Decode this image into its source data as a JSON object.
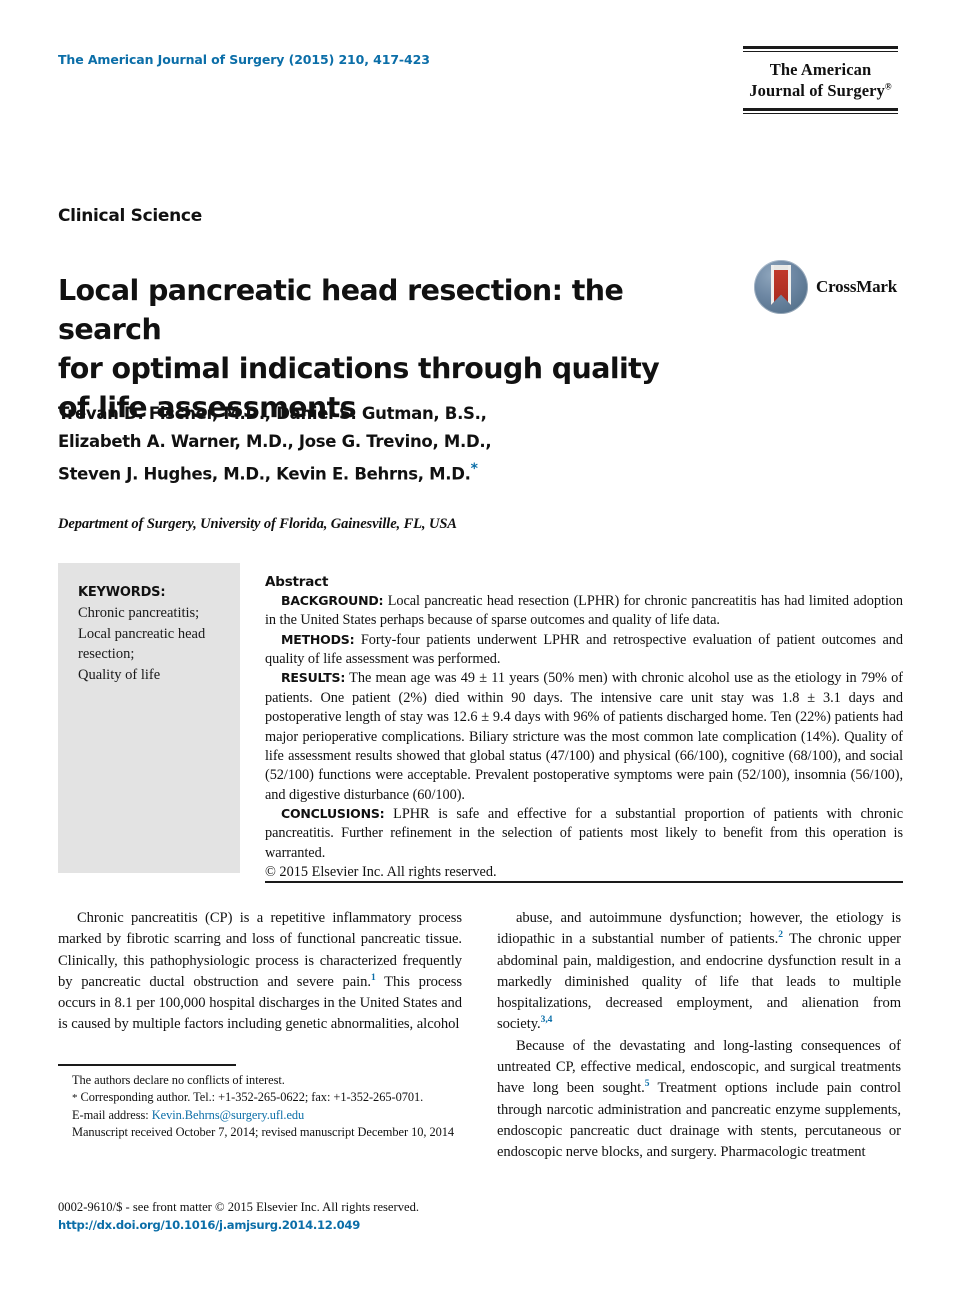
{
  "masthead": {
    "journal_ref": "The American Journal of Surgery (2015) 210, 417-423",
    "logo_line1": "The American",
    "logo_line2": "Journal of Surgery",
    "logo_mark": "®"
  },
  "article": {
    "kicker": "Clinical Science",
    "title_line1": "Local pancreatic head resection: the search",
    "title_line2": "for optimal indications through quality",
    "title_line3": "of life assessments",
    "crossmark_label": "CrossMark",
    "authors_line1": "Trevan D. Fischer, M.D., Daniel S. Gutman, B.S.,",
    "authors_line2": "Elizabeth A. Warner, M.D., Jose G. Trevino, M.D.,",
    "authors_line3": "Steven J. Hughes, M.D., Kevin E. Behrns, M.D.",
    "corresponding_marker": "*",
    "affiliation": "Department of Surgery, University of Florida, Gainesville, FL, USA"
  },
  "keywords": {
    "heading": "KEYWORDS:",
    "line1": "Chronic pancreatitis;",
    "line2": "Local pancreatic head",
    "line3": "resection;",
    "line4": "Quality of life"
  },
  "abstract": {
    "heading": "Abstract",
    "background_label": "BACKGROUND:",
    "background_text": "Local pancreatic head resection (LPHR) for chronic pancreatitis has had limited adoption in the United States perhaps because of sparse outcomes and quality of life data.",
    "methods_label": "METHODS:",
    "methods_text": "Forty-four patients underwent LPHR and retrospective evaluation of patient outcomes and quality of life assessment was performed.",
    "results_label": "RESULTS:",
    "results_text": "The mean age was 49 ± 11 years (50% men) with chronic alcohol use as the etiology in 79% of patients. One patient (2%) died within 90 days. The intensive care unit stay was 1.8 ± 3.1 days and postoperative length of stay was 12.6 ± 9.4 days with 96% of patients discharged home. Ten (22%) patients had major perioperative complications. Biliary stricture was the most common late complication (14%). Quality of life assessment results showed that global status (47/100) and physical (66/100), cognitive (68/100), and social (52/100) functions were acceptable. Prevalent postoperative symptoms were pain (52/100), insomnia (56/100), and digestive disturbance (60/100).",
    "conclusions_label": "CONCLUSIONS:",
    "conclusions_text": "LPHR is safe and effective for a substantial proportion of patients with chronic pancreatitis. Further refinement in the selection of patients most likely to benefit from this operation is warranted.",
    "copyright": "© 2015 Elsevier Inc. All rights reserved."
  },
  "body": {
    "left_p1_a": "Chronic pancreatitis (CP) is a repetitive inflammatory process marked by fibrotic scarring and loss of functional pancreatic tissue. Clinically, this pathophysiologic process is characterized frequently by pancreatic ductal obstruction and severe pain.",
    "left_p1_ref": "1",
    "left_p1_b": " This process occurs in 8.1 per 100,000 hospital discharges in the United States and is caused by multiple factors including genetic abnormalities, alcohol",
    "right_p1_a": "abuse, and autoimmune dysfunction; however, the etiology is idiopathic in a substantial number of patients.",
    "right_p1_ref": "2",
    "right_p1_b": " The chronic upper abdominal pain, maldigestion, and endocrine dysfunction result in a markedly diminished quality of life that leads to multiple hospitalizations, decreased employment, and alienation from society.",
    "right_p1_ref2": "3,4",
    "right_p2_a": "Because of the devastating and long-lasting consequences of untreated CP, effective medical, endoscopic, and surgical treatments have long been sought.",
    "right_p2_ref": "5",
    "right_p2_b": " Treatment options include pain control through narcotic administration and pancreatic enzyme supplements, endoscopic pancreatic duct drainage with stents, percutaneous or endoscopic nerve blocks, and surgery. Pharmacologic treatment"
  },
  "footnotes": {
    "conflicts": "The authors declare no conflicts of interest.",
    "corresponding_marker": "*",
    "corresponding": " Corresponding author. Tel.: +1-352-265-0622; fax: +1-352-265-0701.",
    "email_label": "E-mail address: ",
    "email": "Kevin.Behrns@surgery.ufl.edu",
    "manuscript": "Manuscript received October 7, 2014; revised manuscript December 10, 2014"
  },
  "bottom": {
    "issn_line": "0002-9610/$ - see front matter © 2015 Elsevier Inc. All rights reserved.",
    "doi": "http://dx.doi.org/10.1016/j.amjsurg.2014.12.049"
  },
  "colors": {
    "link_blue": "#0b6ea8",
    "keyword_box_grey": "#e3e3e3",
    "rule_black": "#1a1a1a"
  }
}
